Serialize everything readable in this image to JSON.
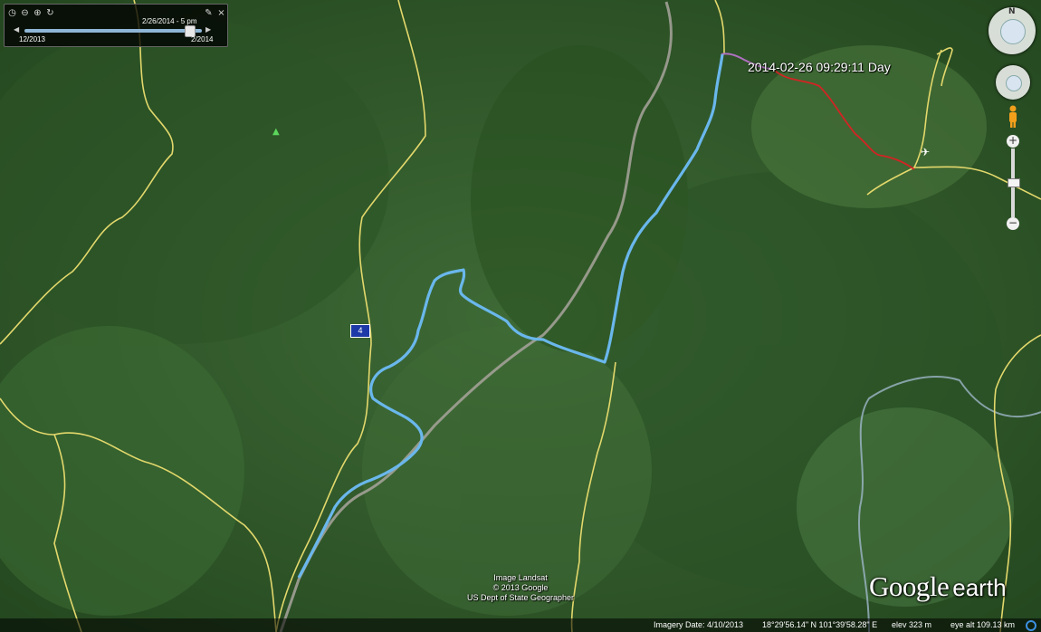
{
  "track": {
    "timestamp_label": "2014-02-26 09:29:11 Day",
    "colors": {
      "gps_track": "#6ab7ec",
      "red_track": "#d22424",
      "borders": "#e3d86c",
      "river": "#9fb7c9",
      "road": "#a8a49c"
    }
  },
  "time_slider": {
    "current_time": "2/26/2014 - 5 pm",
    "start_label": "12/2013",
    "end_label": "2/2014",
    "progress_fraction": 0.95,
    "icons": [
      "clock-icon",
      "zoom-out-icon",
      "zoom-in-icon",
      "refresh-icon",
      "wrench-icon",
      "close-icon"
    ]
  },
  "map": {
    "road_shield": "4",
    "attribution": [
      "Image Landsat",
      "© 2013 Google",
      "US Dept of State Geographer"
    ],
    "logo": {
      "google": "Google",
      "earth": "earth"
    }
  },
  "status_bar": {
    "imagery_date": "Imagery Date: 4/10/2013",
    "coords": "18°29'56.14\" N  101°39'58.28\" E",
    "elev": "elev  323 m",
    "eye_alt": "eye alt 109.13 km"
  },
  "nav": {
    "north": "N",
    "zoom_in": "+",
    "zoom_out": "−"
  }
}
